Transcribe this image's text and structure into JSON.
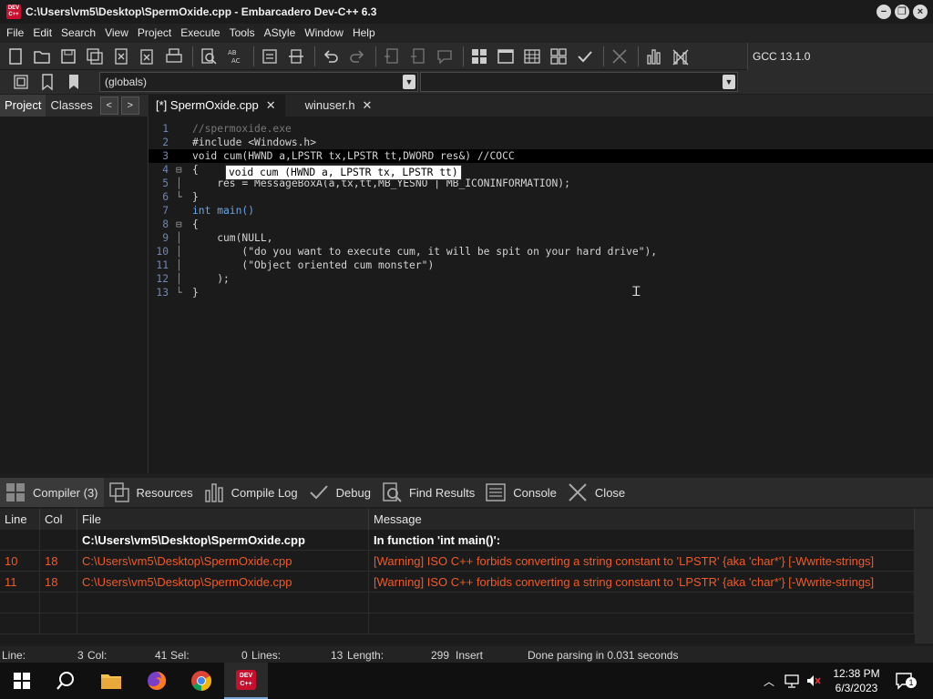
{
  "window": {
    "title": "C:\\Users\\vm5\\Desktop\\SpermOxide.cpp - Embarcadero Dev-C++ 6.3",
    "app_icon_text": "DEV C++"
  },
  "menu": [
    "File",
    "Edit",
    "Search",
    "View",
    "Project",
    "Execute",
    "Tools",
    "AStyle",
    "Window",
    "Help"
  ],
  "compiler_label": "GCC 13.1.0",
  "scope_combo": "(globals)",
  "left_tabs": [
    "Project",
    "Classes"
  ],
  "editor_tabs": [
    {
      "label": "[*] SpermOxide.cpp",
      "active": true
    },
    {
      "label": "winuser.h",
      "active": false
    }
  ],
  "code_lines": [
    "//spermoxide.exe",
    "#include <Windows.h>",
    "void cum(HWND a,LPSTR tx,LPSTR tt,DWORD res&) //COCC",
    "{",
    "    res = MessageBoxA(a,tx,tt,MB_YESNO | MB_ICONINFORMATION);",
    "}",
    "int main()",
    "{",
    "    cum(NULL,",
    "        (\"do you want to execute cum, it will be spit on your hard drive\"),",
    "        (\"Object oriented cum monster\")",
    "    );",
    "}"
  ],
  "line_numbers": [
    "1",
    "2",
    "3",
    "4",
    "5",
    "6",
    "7",
    "8",
    "9",
    "10",
    "11",
    "12",
    "13"
  ],
  "tooltip": "void cum (HWND a, LPSTR tx, LPSTR tt)",
  "bottom_tabs": [
    "Compiler (3)",
    "Resources",
    "Compile Log",
    "Debug",
    "Find Results",
    "Console",
    "Close"
  ],
  "messages": {
    "headers": [
      "Line",
      "Col",
      "File",
      "Message"
    ],
    "rows": [
      {
        "line": "",
        "col": "",
        "file": "C:\\Users\\vm5\\Desktop\\SpermOxide.cpp",
        "message": "In function 'int main()':",
        "kind": "header"
      },
      {
        "line": "10",
        "col": "18",
        "file": "C:\\Users\\vm5\\Desktop\\SpermOxide.cpp",
        "message": "[Warning] ISO C++ forbids converting a string constant to 'LPSTR' {aka 'char*'} [-Wwrite-strings]",
        "kind": "warning"
      },
      {
        "line": "11",
        "col": "18",
        "file": "C:\\Users\\vm5\\Desktop\\SpermOxide.cpp",
        "message": "[Warning] ISO C++ forbids converting a string constant to 'LPSTR' {aka 'char*'} [-Wwrite-strings]",
        "kind": "warning"
      }
    ]
  },
  "status": {
    "line_label": "Line:",
    "line_value": "3",
    "col_label": "Col:",
    "col_value": "41",
    "sel_label": "Sel:",
    "sel_value": "0",
    "lines_label": "Lines:",
    "lines_value": "13",
    "length_label": "Length:",
    "length_value": "299",
    "mode": "Insert",
    "message": "Done parsing in 0.031 seconds"
  },
  "taskbar": {
    "time": "12:38 PM",
    "date": "6/3/2023",
    "notification_count": "1"
  },
  "colors": {
    "warning": "#f05a28",
    "keyword": "#6aa6e6",
    "line_number": "#6f86b8"
  }
}
